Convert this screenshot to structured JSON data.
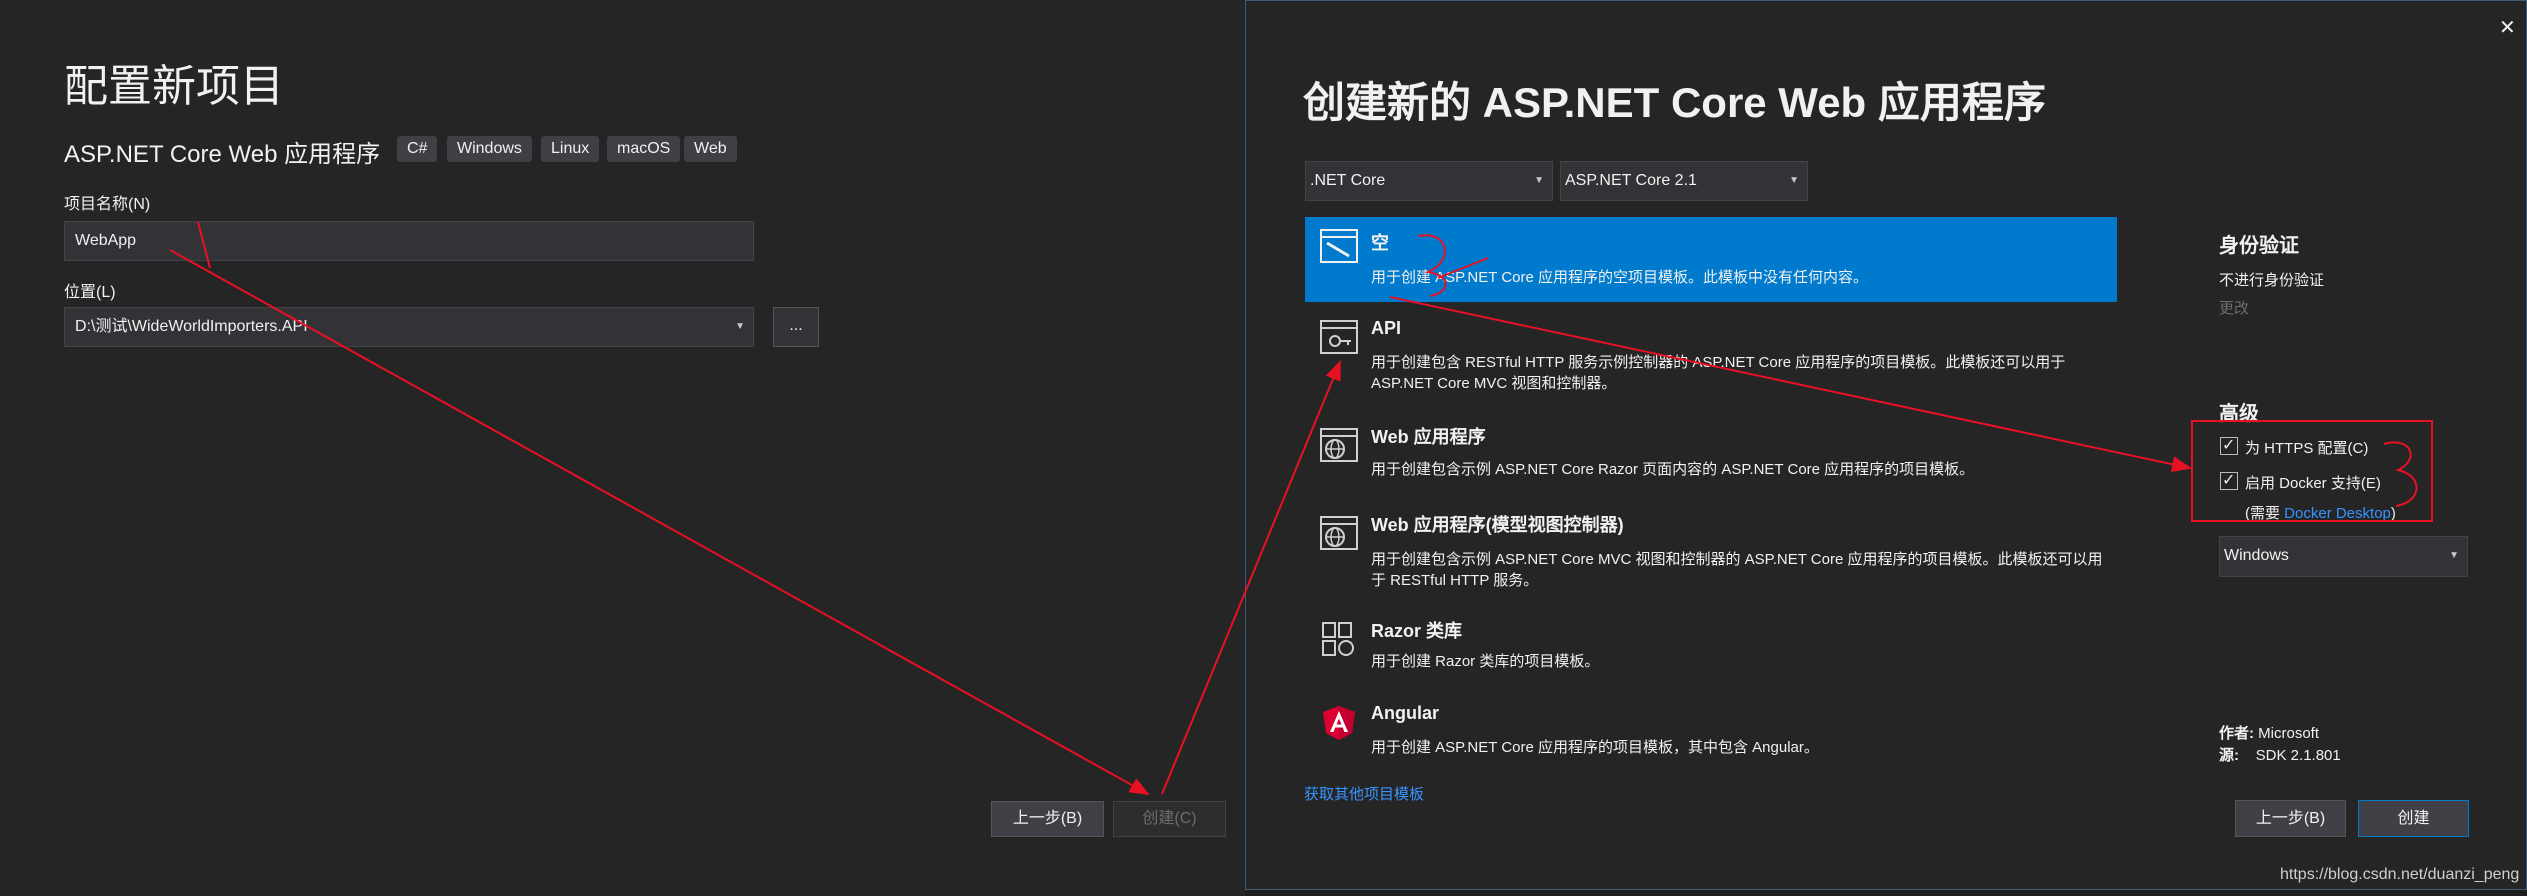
{
  "left": {
    "title": "配置新项目",
    "template_name": "ASP.NET Core Web 应用程序",
    "tags": [
      "C#",
      "Windows",
      "Linux",
      "macOS",
      "Web"
    ],
    "project_name_label": "项目名称(N)",
    "project_name_value": "WebApp",
    "location_label": "位置(L)",
    "location_value": "D:\\测试\\WideWorldImporters.API",
    "browse_label": "...",
    "back_label": "上一步(B)",
    "create_label": "创建(C)"
  },
  "dialog": {
    "title": "创建新的 ASP.NET Core Web 应用程序",
    "framework": ".NET Core",
    "version": "ASP.NET Core 2.1",
    "templates": [
      {
        "name": "空",
        "desc": "用于创建 ASP.NET Core 应用程序的空项目模板。此模板中没有任何内容。",
        "icon": "empty-template-icon",
        "selected": true
      },
      {
        "name": "API",
        "desc": "用于创建包含 RESTful HTTP 服务示例控制器的 ASP.NET Core 应用程序的项目模板。此模板还可以用于 ASP.NET Core MVC 视图和控制器。",
        "icon": "api-template-icon",
        "selected": false
      },
      {
        "name": "Web 应用程序",
        "desc": "用于创建包含示例 ASP.NET Core Razor 页面内容的 ASP.NET Core 应用程序的项目模板。",
        "icon": "web-app-template-icon",
        "selected": false
      },
      {
        "name": "Web 应用程序(模型视图控制器)",
        "desc": "用于创建包含示例 ASP.NET Core MVC 视图和控制器的 ASP.NET Core 应用程序的项目模板。此模板还可以用于 RESTful HTTP 服务。",
        "icon": "mvc-template-icon",
        "selected": false
      },
      {
        "name": "Razor 类库",
        "desc": "用于创建 Razor 类库的项目模板。",
        "icon": "razor-library-icon",
        "selected": false
      },
      {
        "name": "Angular",
        "desc": "用于创建 ASP.NET Core 应用程序的项目模板，其中包含 Angular。",
        "icon": "angular-icon",
        "selected": false
      }
    ],
    "more_templates_link": "获取其他项目模板",
    "auth_heading": "身份验证",
    "auth_value": "不进行身份验证",
    "auth_change": "更改",
    "advanced_heading": "高级",
    "https_label": "为 HTTPS 配置(C)",
    "docker_label": "启用 Docker 支持(E)",
    "docker_note_prefix": "(需要 ",
    "docker_note_link": "Docker Desktop",
    "docker_note_suffix": ")",
    "docker_os": "Windows",
    "author_label": "作者:",
    "author_value": "Microsoft",
    "source_label": "源:",
    "source_value": "SDK 2.1.801",
    "back_label": "上一步(B)",
    "create_label": "创建",
    "close_glyph": "✕"
  },
  "watermark": "https://blog.csdn.net/duanzi_peng",
  "colors": {
    "accent": "#007acc",
    "annotation": "#e81123",
    "link": "#3794ff"
  }
}
